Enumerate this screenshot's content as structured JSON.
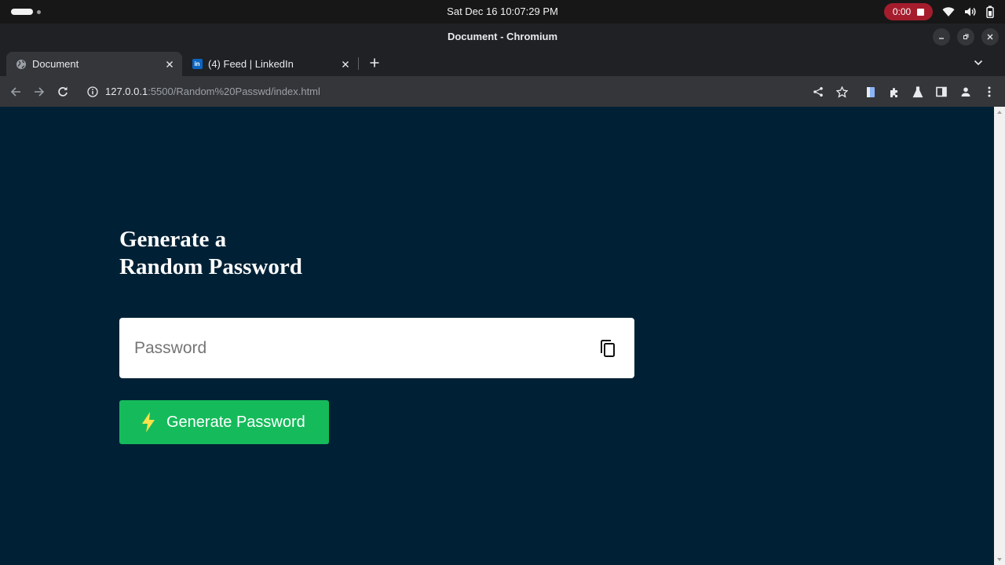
{
  "system_bar": {
    "clock": "Sat Dec 16  10:07:29 PM",
    "recording_time": "0:00"
  },
  "window": {
    "title": "Document - Chromium"
  },
  "tabs": [
    {
      "title": "Document",
      "icon": "globe-icon",
      "active": true
    },
    {
      "title": "(4) Feed | LinkedIn",
      "icon": "linkedin-icon",
      "active": false
    }
  ],
  "linkedin_badge": "in",
  "omnibox": {
    "url_host": "127.0.0.1",
    "url_rest": ":5500/Random%20Passwd/index.html"
  },
  "page": {
    "background": "#002135",
    "heading_line1": "Generate a",
    "heading_line2": "Random Password",
    "password_placeholder": "Password",
    "password_value": "",
    "generate_label": "Generate Password",
    "button_color": "#15bb5b",
    "bolt_color": "#f9e24b"
  }
}
